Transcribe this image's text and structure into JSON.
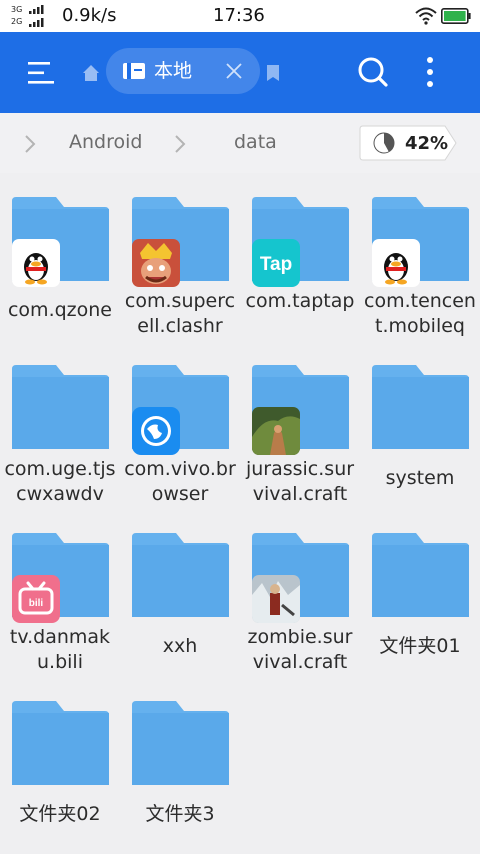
{
  "status_bar": {
    "net_top": "3G",
    "net_bottom": "2G",
    "speed": "0.9k/s",
    "time": "17:36"
  },
  "app_bar": {
    "location_chip": "本地"
  },
  "breadcrumb": {
    "items": [
      "Android",
      "data"
    ]
  },
  "storage": {
    "usage": "42%",
    "usage_fraction": 0.42
  },
  "files": [
    {
      "name": "com.qzone",
      "icon": "qq-penguin-icon"
    },
    {
      "name": "com.supercell.clashr",
      "icon": "clash-royale-icon"
    },
    {
      "name": "com.taptap",
      "icon": "taptap-icon"
    },
    {
      "name": "com.tencent.mobileq",
      "icon": "qq-penguin-icon"
    },
    {
      "name": "com.uge.tjscwxawdv",
      "icon": ""
    },
    {
      "name": "com.vivo.browser",
      "icon": "vivo-browser-icon"
    },
    {
      "name": "jurassic.survival.craft",
      "icon": "jurassic-game-icon"
    },
    {
      "name": "system",
      "icon": ""
    },
    {
      "name": "tv.danmaku.bili",
      "icon": "bilibili-icon"
    },
    {
      "name": "xxh",
      "icon": ""
    },
    {
      "name": "zombie.survival.craft",
      "icon": "zombie-game-icon"
    },
    {
      "name": "文件夹01",
      "icon": ""
    },
    {
      "name": "文件夹02",
      "icon": ""
    },
    {
      "name": "文件夹3",
      "icon": ""
    }
  ],
  "colors": {
    "accent": "#1e6ee6",
    "folder": "#5aa9ea",
    "folder_tab": "#65b1ee",
    "background": "#efeff1"
  }
}
